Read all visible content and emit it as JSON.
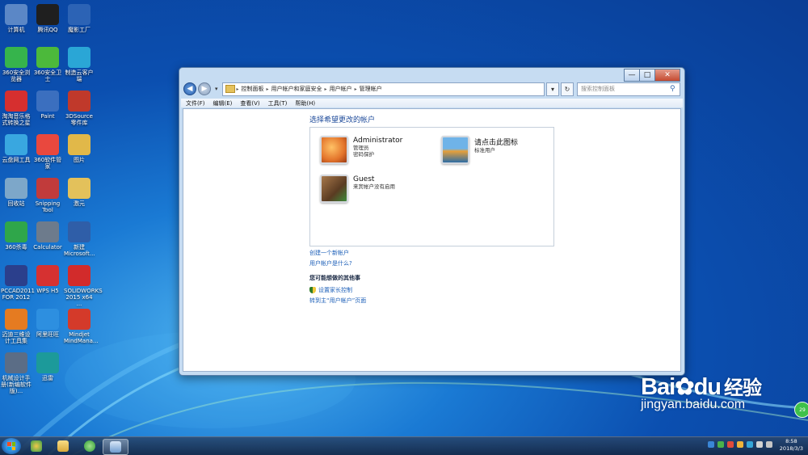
{
  "desktop": {
    "icons": [
      {
        "label": "计算机",
        "icon": "computer-icon",
        "color": "#5b87c6"
      },
      {
        "label": "腾讯QQ",
        "icon": "qq-icon",
        "color": "#1f1f1f"
      },
      {
        "label": "魔影工厂",
        "icon": "magic-factory-icon",
        "color": "#2c63b5"
      },
      {
        "label": "360安全浏览器",
        "icon": "360-browser-icon",
        "color": "#36b44c"
      },
      {
        "label": "360安全卫士",
        "icon": "360-guard-icon",
        "color": "#4cb93b"
      },
      {
        "label": "制造云客户端",
        "icon": "cloud-client-icon",
        "color": "#2aa6d6"
      },
      {
        "label": "淘淘音乐格式转换之星",
        "icon": "music-converter-icon",
        "color": "#d62f2f"
      },
      {
        "label": "Paint",
        "icon": "paint-icon",
        "color": "#3b6fbf"
      },
      {
        "label": "3DSource零件库",
        "icon": "3dsource-icon",
        "color": "#c0392b"
      },
      {
        "label": "云盘网工具",
        "icon": "cloud-disk-icon",
        "color": "#39a7e0"
      },
      {
        "label": "360软件管家",
        "icon": "360-software-icon",
        "color": "#e9483e"
      },
      {
        "label": "图片",
        "icon": "pictures-folder-icon",
        "color": "#e1b849"
      },
      {
        "label": "回收站",
        "icon": "recycle-bin-icon",
        "color": "#7da7c9"
      },
      {
        "label": "Snipping Tool",
        "icon": "snipping-tool-icon",
        "color": "#c13b3b"
      },
      {
        "label": "激元",
        "icon": "folder-icon",
        "color": "#e3c15b"
      },
      {
        "label": "360杀毒",
        "icon": "360-antivirus-icon",
        "color": "#2fa64a"
      },
      {
        "label": "Calculator",
        "icon": "calculator-icon",
        "color": "#6d7b8c"
      },
      {
        "label": "新建 Microsoft...",
        "icon": "word-doc-icon",
        "color": "#2f5ea8"
      },
      {
        "label": "PCCAD2011 FOR 2012",
        "icon": "pccad-icon",
        "color": "#2b3f8c"
      },
      {
        "label": "WPS H5",
        "icon": "wps-icon",
        "color": "#d63131"
      },
      {
        "label": "SOLIDWORKS 2015 x64 ...",
        "icon": "solidworks-icon",
        "color": "#d22b2b"
      },
      {
        "label": "迈迪三维设计工具集",
        "icon": "maidi-icon",
        "color": "#e57b21"
      },
      {
        "label": "阿里旺旺",
        "icon": "aliwangwang-icon",
        "color": "#2d8fe0"
      },
      {
        "label": "Mindjet MindMana...",
        "icon": "mindjet-icon",
        "color": "#d43a2a"
      },
      {
        "label": "机械设计手册(新编软件版)...",
        "icon": "handbook-icon",
        "color": "#5b6d86"
      },
      {
        "label": "迅雷",
        "icon": "xunlei-icon",
        "color": "#1c9a9a"
      }
    ]
  },
  "window": {
    "controls": {
      "minimize": "—",
      "maximize": "□",
      "close": "✕"
    },
    "nav": {
      "back": "◀",
      "forward": "▶",
      "dropdown": "▾"
    },
    "breadcrumbs": [
      "控制面板",
      "用户帐户和家庭安全",
      "用户帐户",
      "管理帐户"
    ],
    "breadcrumb_sep": "▸",
    "refresh": "↻",
    "search_placeholder": "搜索控制面板",
    "menu": [
      "文件(F)",
      "编辑(E)",
      "查看(V)",
      "工具(T)",
      "帮助(H)"
    ],
    "heading": "选择希望更改的帐户",
    "accounts": [
      {
        "name": "Administrator",
        "lines": [
          "管理员",
          "密码保护"
        ],
        "pic_color": "#e3742b"
      },
      {
        "name": "请点击此图标",
        "lines": [
          "标准用户"
        ],
        "pic_color": "#3b7fb8"
      },
      {
        "name": "Guest",
        "lines": [
          "来宾帐户没有启用"
        ],
        "pic_color": "#7b5a3c"
      }
    ],
    "links": {
      "create": "创建一个新帐户",
      "what_is": "用户帐户是什么?"
    },
    "other_title": "您可能想做的其他事",
    "parental": "设置家长控制",
    "goto_main": "转到主“用户帐户”页面"
  },
  "taskbar": {
    "clock_time": "8:58",
    "clock_date": "2018/3/3",
    "apps": [
      "360-browser",
      "explorer",
      "360-guard",
      "control-panel"
    ]
  },
  "watermark": {
    "brand": "Bai",
    "brand2": "du",
    "brand_cn": "经验",
    "url": "jingyan.baidu.com",
    "badge": "29"
  }
}
